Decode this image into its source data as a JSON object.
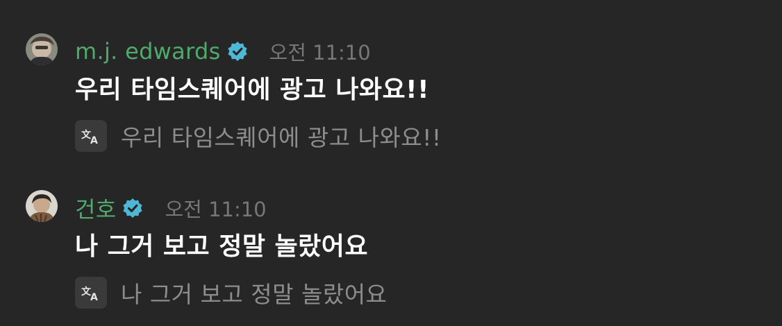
{
  "messages": [
    {
      "username": "m.j. edwards",
      "verified": true,
      "timestamp": "오전 11:10",
      "text": "우리 타임스퀘어에 광고 나와요!!",
      "translation": "우리 타임스퀘어에 광고 나와요!!"
    },
    {
      "username": "건호",
      "verified": true,
      "timestamp": "오전 11:10",
      "text": "나 그거 보고 정말 놀랐어요",
      "translation": "나 그거 보고 정말 놀랐어요"
    }
  ],
  "colors": {
    "background": "#262626",
    "username": "#4eab6b",
    "verified_badge": "#4fb7d6",
    "timestamp": "#777777",
    "message_text": "#ffffff",
    "translation_text": "#8d8d8d",
    "translate_button_bg": "#3a3a3a"
  },
  "icons": {
    "verified": "verified-badge-icon",
    "translate": "translate-icon"
  }
}
